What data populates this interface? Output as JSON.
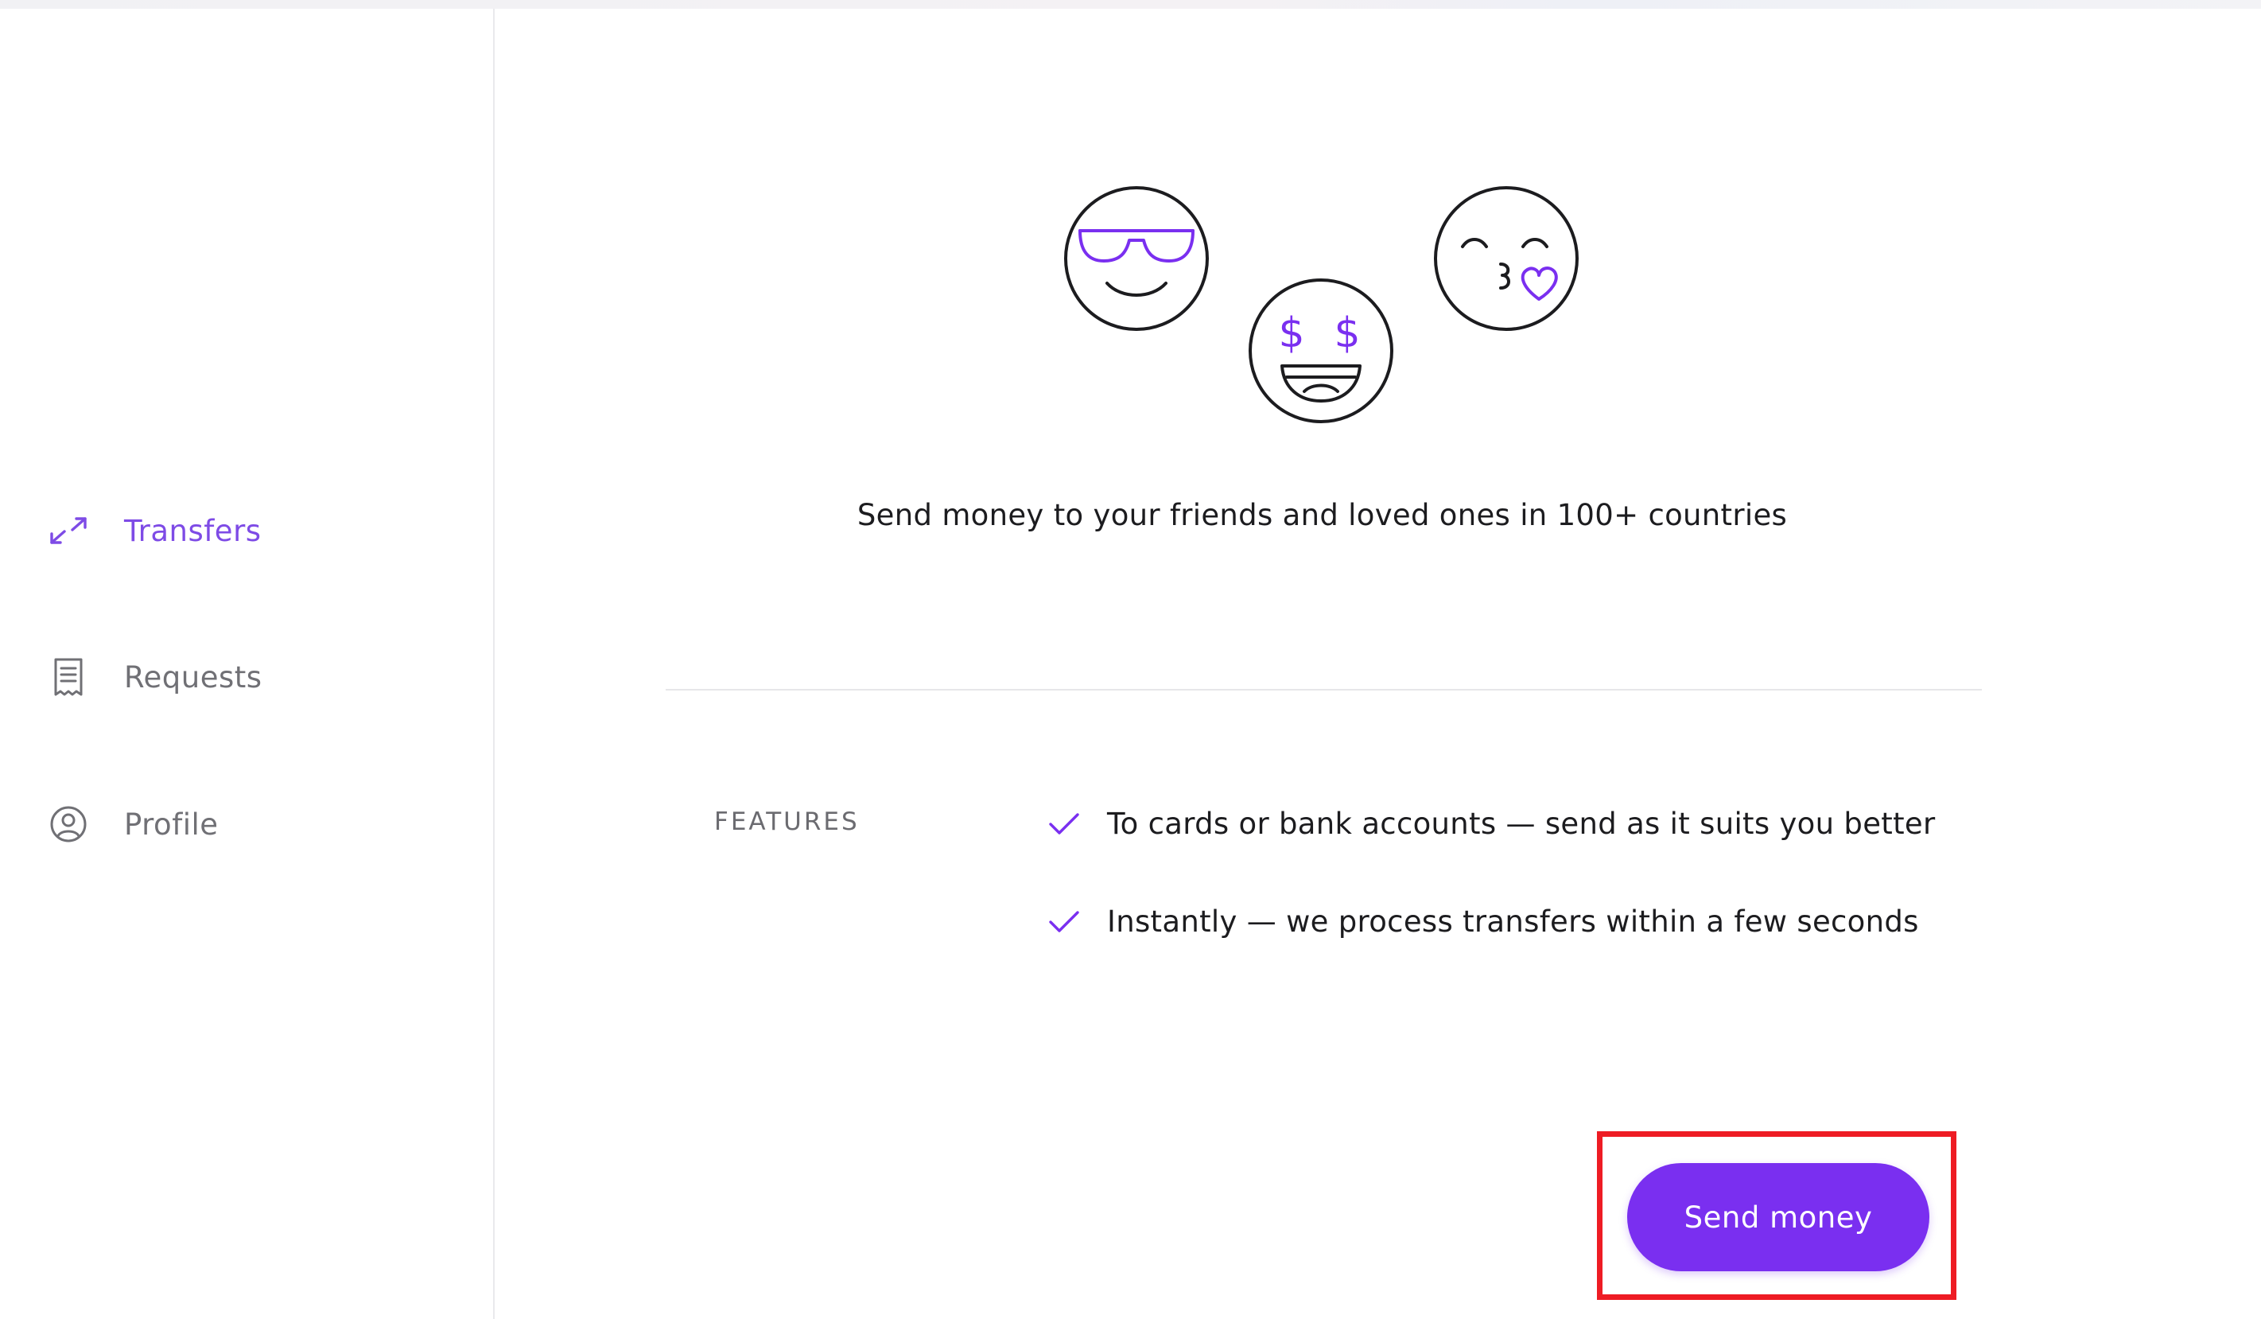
{
  "colors": {
    "accent": "#7a2ff0",
    "accent_text": "#7e4be6",
    "nav_inactive": "#707075",
    "highlight": "#ee1c24"
  },
  "sidebar": {
    "items": [
      {
        "label": "Transfers",
        "icon": "transfer-arrows-icon",
        "active": true
      },
      {
        "label": "Requests",
        "icon": "receipt-icon",
        "active": false
      },
      {
        "label": "Profile",
        "icon": "user-circle-icon",
        "active": false
      }
    ]
  },
  "main": {
    "emojis": [
      "sunglasses-face-icon",
      "money-eyes-face-icon",
      "kissing-heart-face-icon"
    ],
    "headline": "Send money to your friends and loved ones in 100+ countries",
    "features_label": "FEATURES",
    "features": [
      {
        "icon": "checkmark-icon",
        "text": "To cards or bank accounts — send as it suits you better"
      },
      {
        "icon": "checkmark-icon",
        "text": "Instantly — we process transfers within a few seconds"
      }
    ],
    "send_button_label": "Send money"
  }
}
